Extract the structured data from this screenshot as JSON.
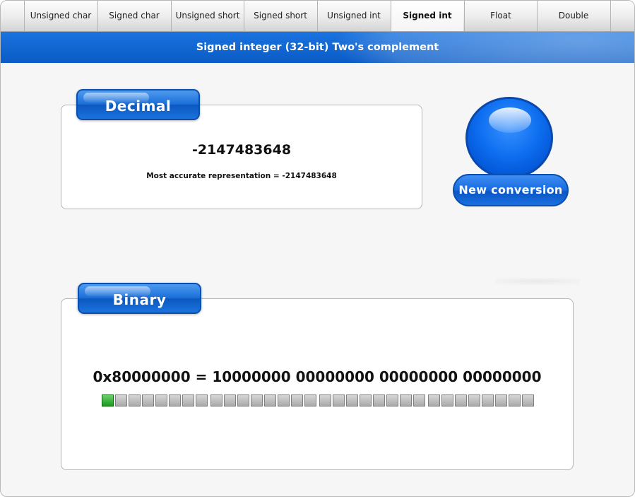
{
  "tabs": [
    {
      "label": "Unsigned char",
      "active": false
    },
    {
      "label": "Signed char",
      "active": false
    },
    {
      "label": "Unsigned short",
      "active": false
    },
    {
      "label": "Signed short",
      "active": false
    },
    {
      "label": "Unsigned int",
      "active": false
    },
    {
      "label": "Signed int",
      "active": true
    },
    {
      "label": "Float",
      "active": false
    },
    {
      "label": "Double",
      "active": false
    }
  ],
  "banner": {
    "title": "Signed integer (32-bit) Two's complement"
  },
  "decimal": {
    "label": "Decimal",
    "value": "-2147483648",
    "note": "Most accurate representation = -2147483648"
  },
  "new_conversion": {
    "label": "New conversion"
  },
  "binary": {
    "label": "Binary",
    "value": "0x80000000 = 10000000 00000000 00000000 00000000",
    "bits": [
      1,
      0,
      0,
      0,
      0,
      0,
      0,
      0,
      0,
      0,
      0,
      0,
      0,
      0,
      0,
      0,
      0,
      0,
      0,
      0,
      0,
      0,
      0,
      0,
      0,
      0,
      0,
      0,
      0,
      0,
      0,
      0
    ]
  },
  "colors": {
    "accent": "#0a5bc5",
    "bit_on": "#1a9a1a",
    "bit_off": "#b5b5b5"
  }
}
